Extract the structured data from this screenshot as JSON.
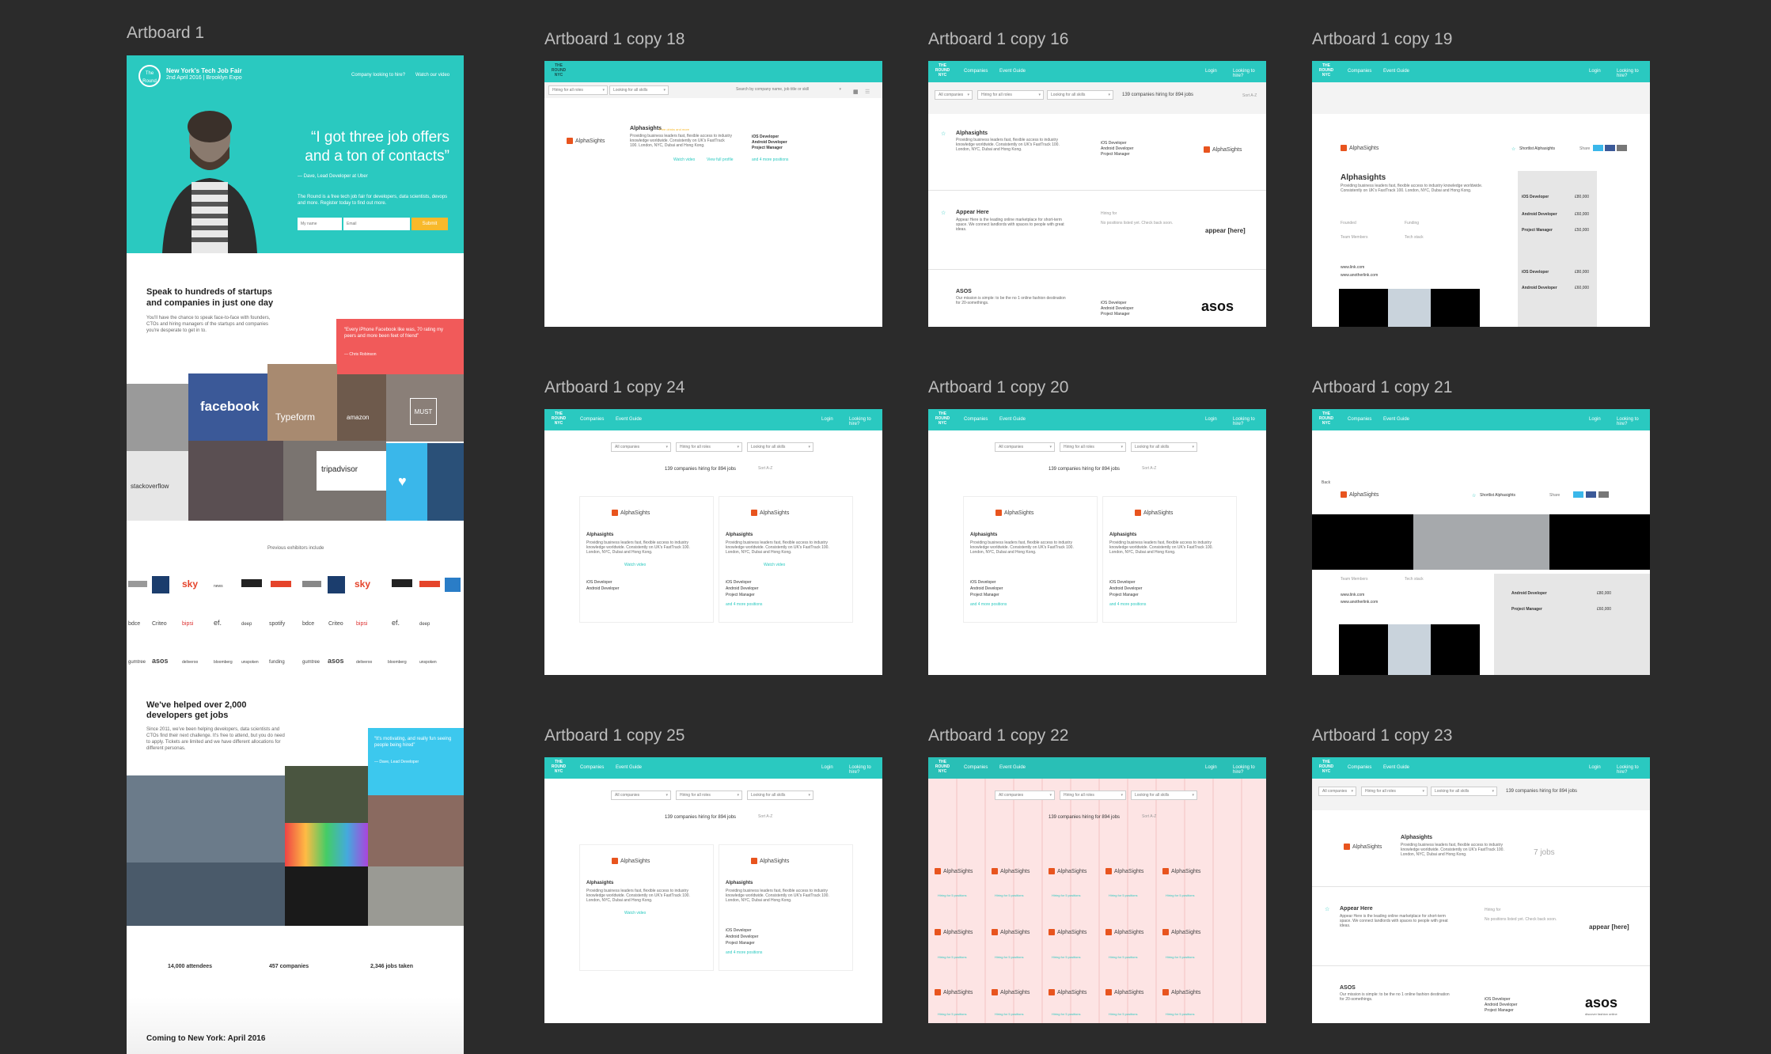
{
  "artboards": {
    "a1": "Artboard 1",
    "a18": "Artboard 1 copy 18",
    "a16": "Artboard 1 copy 16",
    "a19": "Artboard 1 copy 19",
    "a24": "Artboard 1 copy 24",
    "a20": "Artboard 1 copy 20",
    "a21": "Artboard 1 copy 21",
    "a25": "Artboard 1 copy 25",
    "a22": "Artboard 1 copy 22",
    "a23": "Artboard 1 copy 23"
  },
  "landing": {
    "event_title": "New York's Tech Job Fair",
    "event_date": "2nd April 2016 | Brooklyn Expo",
    "nav_companies": "Company looking to hire?",
    "nav_video": "Watch our video",
    "quote": "“I got three job offers and a ton of contacts”",
    "quote_author": "— Dave, Lead Developer at Uber",
    "intro": "The Round is a free tech job fair for developers, data scientists, devops and more. Register today to find out more.",
    "name_placeholder": "My name",
    "email_placeholder": "Email",
    "submit": "Submit",
    "speak_heading": "Speak to hundreds of startups and companies in just one day",
    "speak_body": "You'll have the chance to speak face-to-face with founders, CTOs and hiring managers of the startups and companies you're desperate to get in to.",
    "red_quote": "“Every iPhone Facebook like was, 70 rating my peers and more been feet of friend”",
    "red_quote_author": "— Chris Robinson",
    "logo_facebook": "facebook",
    "logo_tripadvisor": "tripadvisor",
    "logo_stackoverflow": "stackoverflow",
    "logo_amazon": "amazon",
    "logo_must": "MUST",
    "logo_typeform": "Typeform",
    "previous_exhibitors": "Previous exhibitors include",
    "helped_heading": "We've helped over 2,000 developers get jobs",
    "helped_body": "Since 2011, we've been helping developers, data scientists and CTOs find their next challenge. It's free to attend, but you do need to apply. Tickets are limited and we have different allocations for different personas.",
    "blue_quote": "“It's motivating, and really fun seeing people being hired”",
    "blue_quote_author": "— Dave, Lead Developer",
    "stat_attendees": "14,000 attendees",
    "stat_companies": "457 companies",
    "stat_jobs": "2,346 jobs taken",
    "coming": "Coming to New York: April 2016"
  },
  "nav": {
    "logo": "THE ROUND NYC",
    "companies": "Companies",
    "event_guide": "Event Guide",
    "login": "Login",
    "looking": "Looking to hire?"
  },
  "filters": {
    "all_companies": "All companies",
    "hiring_all_roles": "Hiring for all roles",
    "looking_all_skills": "Looking for all skills",
    "search_placeholder": "Search by company name, job title or skill",
    "count_text": "139 companies hiring for 894 jobs",
    "sort": "Sort A-Z"
  },
  "company": {
    "name": "Alphasights",
    "logo": "AlphaSights",
    "tag": "Free drinks and more",
    "desc": "Providing business leaders fast, flexible access to industry knowledge worldwide. Consistently on UK's FastTrack 100. London, NYC, Dubai and Hong Kong.",
    "watch": "Watch video",
    "profile": "View full profile",
    "job1": "iOS Developer",
    "job2": "Android Developer",
    "job3": "Project Manager",
    "more_positions": "and 4 more positions",
    "hiring": "Hiring for 5 positions",
    "seven_jobs": "7 jobs"
  },
  "appear": {
    "name": "Appear Here",
    "desc": "Appear Here is the leading online marketplace for short-term space. We connect landlords with spaces to people with great ideas.",
    "logo": "appear [here]",
    "hiring": "Hiring for",
    "note": "No positions listed yet. Check back soon."
  },
  "asos": {
    "name": "ASOS",
    "desc": "Our mission is simple: to be the no 1 online fashion destination for 20-somethings.",
    "logo": "asos",
    "sub": "discover fashion online"
  },
  "profile": {
    "back": "Back",
    "shortlist": "Shortlist Alphasights",
    "share": "Share",
    "founded": "Founded",
    "funding": "Funding",
    "team": "Team Members",
    "tech": "Tech stack",
    "site": "www.link.com",
    "site2": "www.anotherlink.com",
    "salary1": "£80,000",
    "salary2": "£60,000",
    "salary3": "£50,000"
  },
  "colors": {
    "teal": "#2ac9c0",
    "red": "#f15a5a",
    "blue": "#3cc8ee",
    "yellow": "#f8b92b",
    "bg": "#2b2b2b"
  }
}
